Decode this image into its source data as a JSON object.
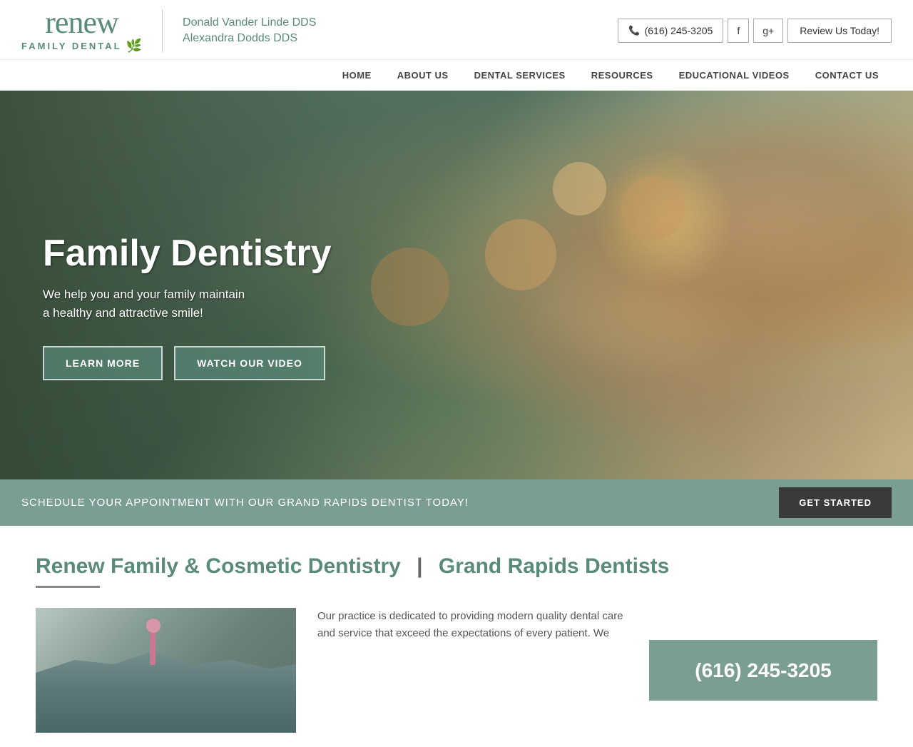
{
  "header": {
    "logo": {
      "renew": "renew",
      "family": "FAMILY DENTAL",
      "leaf": "🌿"
    },
    "doctors": {
      "doctor1": "Donald Vander Linde DDS",
      "doctor2": "Alexandra Dodds DDS"
    },
    "phone": "(616) 245-3205",
    "review": "Review Us Today!",
    "facebook": "f",
    "gplus": "g+"
  },
  "nav": {
    "items": [
      {
        "label": "HOME"
      },
      {
        "label": "ABOUT US"
      },
      {
        "label": "DENTAL SERVICES"
      },
      {
        "label": "RESOURCES"
      },
      {
        "label": "EDUCATIONAL VIDEOS"
      },
      {
        "label": "CONTACT US"
      }
    ]
  },
  "hero": {
    "title": "Family Dentistry",
    "subtitle_line1": "We help you and your family maintain",
    "subtitle_line2": "a healthy and attractive smile!",
    "btn_learn": "LEARN MORE",
    "btn_video": "WATCH OUR VIDEO"
  },
  "schedule_bar": {
    "text": "SCHEDULE YOUR APPOINTMENT WITH OUR GRAND RAPIDS DENTIST TODAY!",
    "btn": "GET STARTED"
  },
  "main": {
    "heading_part1": "Renew Family & Cosmetic Dentistry",
    "pipe": "|",
    "heading_part2": "Grand Rapids Dentists",
    "body_text": "Our practice is dedicated to providing modern quality dental care and service that exceed the expectations of every patient. We",
    "phone": "(616) 245-3205"
  }
}
